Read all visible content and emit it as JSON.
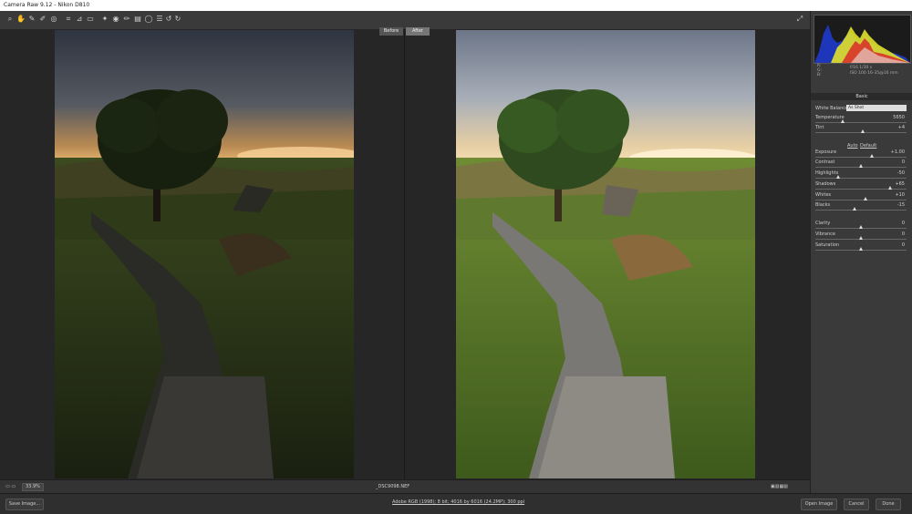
{
  "window": {
    "title": "Camera Raw 9.12  -  Nikon D810"
  },
  "toolbar": {
    "tools": [
      "zoom-icon",
      "hand-icon",
      "white-balance-icon",
      "color-sampler-icon",
      "target-adjust-icon",
      "crop-icon",
      "straighten-icon",
      "transform-icon",
      "spot-removal-icon",
      "red-eye-icon",
      "adjustment-brush-icon",
      "graduated-filter-icon",
      "radial-filter-icon",
      "preferences-icon",
      "rotate-left-icon",
      "rotate-right-icon"
    ],
    "tool_glyphs": [
      "⌕",
      "✋",
      "✎",
      "✐",
      "◎",
      "⌗",
      "⊿",
      "▭",
      "✦",
      "◉",
      "✏",
      "▤",
      "◯",
      "☰",
      "↺",
      "↻"
    ]
  },
  "view": {
    "before_label": "Before",
    "after_label": "After"
  },
  "status": {
    "zoom": "33.9%",
    "filename": "_DSC9098.NEF"
  },
  "bottom": {
    "save_label": "Save Image...",
    "workflow_link": "Adobe RGB (1998); 8 bit; 4016 by 6016 (24.2MP); 300 ppi",
    "open_label": "Open Image",
    "cancel_label": "Cancel",
    "done_label": "Done"
  },
  "readout": {
    "r": "R:",
    "g": "G:",
    "b": "B:",
    "line1": "f/16    1/30 s",
    "line2": "ISO 100    16-35@16 mm"
  },
  "panel": {
    "title": "Basic",
    "white_balance_label": "White Balance:",
    "white_balance_value": "As Shot",
    "auto_label": "Auto",
    "default_label": "Default",
    "sliders": [
      {
        "label": "Temperature",
        "value": "5650",
        "pos": 0.3
      },
      {
        "label": "Tint",
        "value": "+4",
        "pos": 0.52
      },
      {
        "label": "Exposure",
        "value": "+1.00",
        "pos": 0.62
      },
      {
        "label": "Contrast",
        "value": "0",
        "pos": 0.5
      },
      {
        "label": "Highlights",
        "value": "-50",
        "pos": 0.25
      },
      {
        "label": "Shadows",
        "value": "+65",
        "pos": 0.82
      },
      {
        "label": "Whites",
        "value": "+10",
        "pos": 0.55
      },
      {
        "label": "Blacks",
        "value": "-15",
        "pos": 0.43
      },
      {
        "label": "Clarity",
        "value": "0",
        "pos": 0.5
      },
      {
        "label": "Vibrance",
        "value": "0",
        "pos": 0.5
      },
      {
        "label": "Saturation",
        "value": "0",
        "pos": 0.5
      }
    ]
  }
}
